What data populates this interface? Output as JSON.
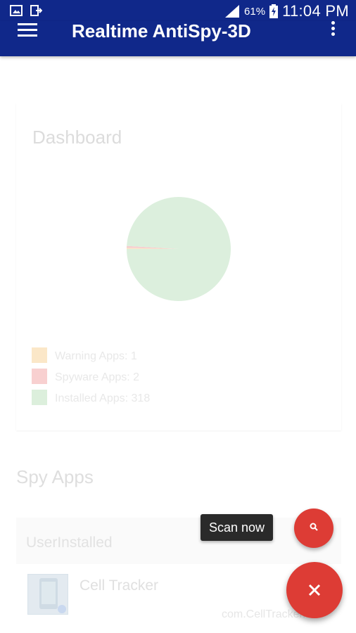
{
  "status_bar": {
    "left_icons": [
      "image-icon",
      "cast-icon"
    ],
    "battery": "61%",
    "time": "11:04 PM"
  },
  "app_bar": {
    "title": "Realtime AntiSpy-3D"
  },
  "dashboard": {
    "title": "Dashboard",
    "legend": [
      {
        "label": "Warning Apps: 1",
        "color": "#fbe7c8"
      },
      {
        "label": "Spyware Apps: 2",
        "color": "#f8d0d0"
      },
      {
        "label": "Installed Apps: 318",
        "color": "#dcefdc"
      }
    ]
  },
  "chart_data": {
    "type": "pie",
    "title": "",
    "slices": [
      {
        "label": "Warning Apps",
        "value": 1,
        "color": "#fbe7c8"
      },
      {
        "label": "Spyware Apps",
        "value": 2,
        "color": "#f6cfcf"
      },
      {
        "label": "Installed Apps",
        "value": 318,
        "color": "#dcefdd"
      }
    ]
  },
  "spy_apps": {
    "title": "Spy Apps",
    "group_label": "UserInstalled",
    "items": [
      {
        "name": "Cell Tracker",
        "package": "com.CellTracker.ec"
      }
    ]
  },
  "fab": {
    "tooltip": "Scan now",
    "mini_icon": "search-icon",
    "main_icon": "close-icon"
  },
  "colors": {
    "primary": "#10288a",
    "accent": "#dd3c35"
  }
}
